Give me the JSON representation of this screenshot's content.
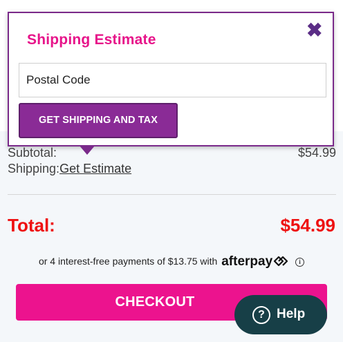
{
  "popup": {
    "title": "Shipping Estimate",
    "close_glyph": "✖",
    "postal_placeholder": "Postal Code",
    "postal_value": "",
    "submit_label": "GET SHIPPING AND TAX"
  },
  "summary": {
    "subtotal_label": "Subtotal:",
    "subtotal_value": "$54.99",
    "shipping_label": "Shipping:",
    "shipping_link": "Get Estimate",
    "total_label": "Total:",
    "total_value": "$54.99"
  },
  "afterpay": {
    "text": "or 4 interest-free payments of $13.75 with",
    "brand": "afterpay",
    "info_glyph": "i"
  },
  "checkout": {
    "label": "CHECKOUT"
  },
  "help": {
    "label": "Help",
    "icon_glyph": "?"
  },
  "colors": {
    "brand_pink": "#ec138e",
    "title_pink": "#e7148a",
    "button_purple": "#8a2b96",
    "total_red": "#ee1111",
    "help_dark_teal": "#173f47"
  }
}
